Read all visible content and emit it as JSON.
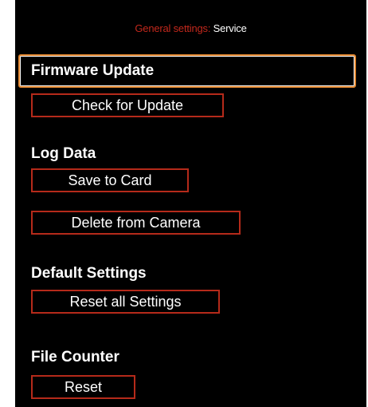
{
  "header": {
    "breadcrumb": "General settings:",
    "title": "Service"
  },
  "sections": {
    "firmware": {
      "title": "Firmware Update",
      "button": "Check for Update"
    },
    "log": {
      "title": "Log Data",
      "save_button": "Save to Card",
      "delete_button": "Delete from Camera"
    },
    "defaults": {
      "title": "Default Settings",
      "button": "Reset all Settings"
    },
    "counter": {
      "title": "File Counter",
      "button": "Reset"
    }
  },
  "colors": {
    "background": "#000000",
    "accent_red": "#b52a1a",
    "selection_orange": "#e0852e",
    "text": "#ffffff"
  }
}
